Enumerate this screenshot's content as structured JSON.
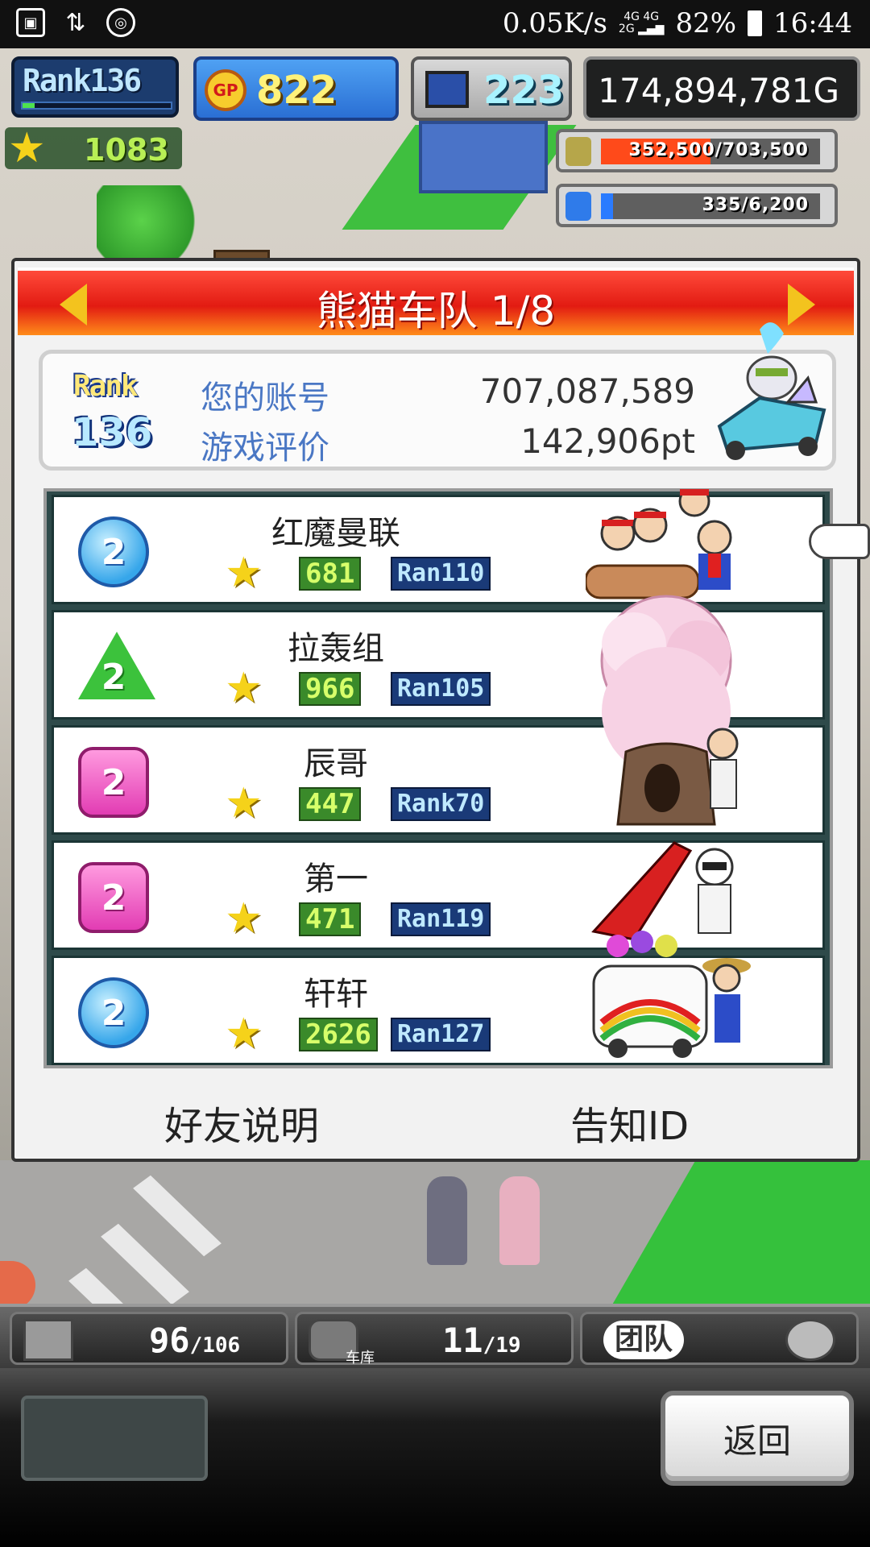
{
  "status_bar": {
    "speed": "0.05K/s",
    "network": "4G 4G 2G",
    "battery": "82%",
    "time": "16:44"
  },
  "hud": {
    "rank_label": "Rank136",
    "rank_progress": 0.08,
    "gp": "822",
    "pc_count": "223",
    "money": "174,894,781G",
    "stars": "1083",
    "resources": [
      {
        "icon": "coin-stack-icon",
        "text": "352,500/703,500",
        "fraction": 0.5,
        "color": "#ff4a1a"
      },
      {
        "icon": "bottle-icon",
        "text": "335/6,200",
        "fraction": 0.054,
        "color": "#2a7bff"
      }
    ]
  },
  "dialog": {
    "title": "熊猫车队 1/8",
    "account": {
      "rank_label": "Rank",
      "rank_value": "136",
      "account_label": "您的账号",
      "account_value": "707,087,589",
      "rating_label": "游戏评价",
      "rating_value": "142,906pt"
    },
    "friends": [
      {
        "badge_shape": "circle",
        "badge_num": "2",
        "name": "红魔曼联",
        "stars": "681",
        "rank": "Ran110"
      },
      {
        "badge_shape": "tri",
        "badge_num": "2",
        "name": "拉轰组",
        "stars": "966",
        "rank": "Ran105"
      },
      {
        "badge_shape": "square",
        "badge_num": "2",
        "name": "辰哥",
        "stars": "447",
        "rank": "Rank70"
      },
      {
        "badge_shape": "square",
        "badge_num": "2",
        "name": "第一",
        "stars": "471",
        "rank": "Ran119"
      },
      {
        "badge_shape": "circle",
        "badge_num": "2",
        "name": "轩轩",
        "stars": "2626",
        "rank": "Ran127"
      }
    ],
    "footer": {
      "friend_help": "好友说明",
      "notify_id": "告知ID"
    }
  },
  "bottom_hud": {
    "crates": {
      "current": "96",
      "max": "106"
    },
    "garage": {
      "label": "车库",
      "current": "11",
      "max": "19"
    },
    "team": {
      "label": "团队"
    }
  },
  "bottom_bar": {
    "back": "返回"
  }
}
